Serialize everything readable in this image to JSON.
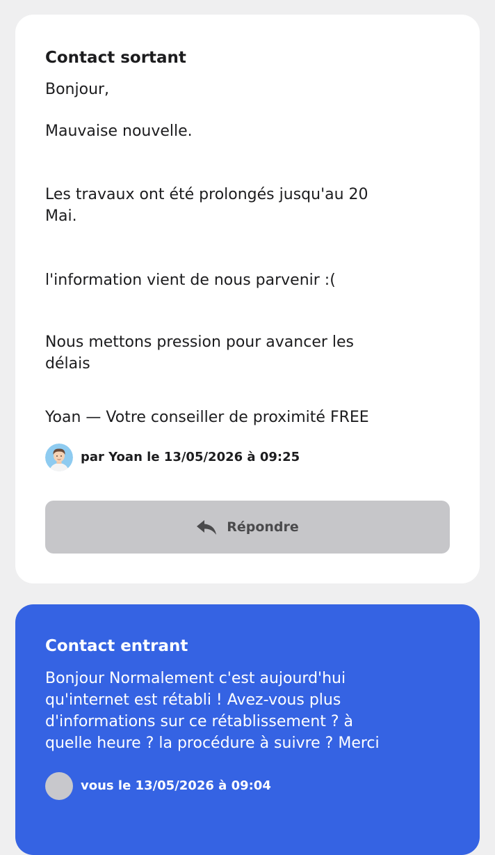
{
  "outgoing": {
    "title": "Contact sortant",
    "lines": [
      "Bonjour,",
      "Mauvaise nouvelle.",
      "Les travaux ont été prolongés jusqu'au 20",
      "Mai.",
      "l'information vient de nous parvenir :(",
      "Nous mettons pression pour avancer les",
      "délais",
      "Yoan — Votre conseiller de proximité FREE"
    ],
    "author": "par Yoan le 13/05/2026 à 09:25",
    "avatar_icon": "person-avatar-icon",
    "reply_label": "Répondre",
    "reply_icon": "reply-arrow-icon"
  },
  "incoming": {
    "title": "Contact entrant",
    "lines": [
      "Bonjour Normalement c'est aujourd'hui",
      "qu'internet est rétabli ! Avez-vous plus",
      "d'informations sur ce rétablissement ? à",
      "quelle heure ? la procédure à suivre ? Merci"
    ],
    "author": "vous le 13/05/2026 à 09:04",
    "avatar_icon": "placeholder-avatar-icon"
  },
  "colors": {
    "background": "#efeff0",
    "incoming_card": "#3563e3",
    "outgoing_card": "#ffffff",
    "reply_button": "#c6c6c9"
  }
}
